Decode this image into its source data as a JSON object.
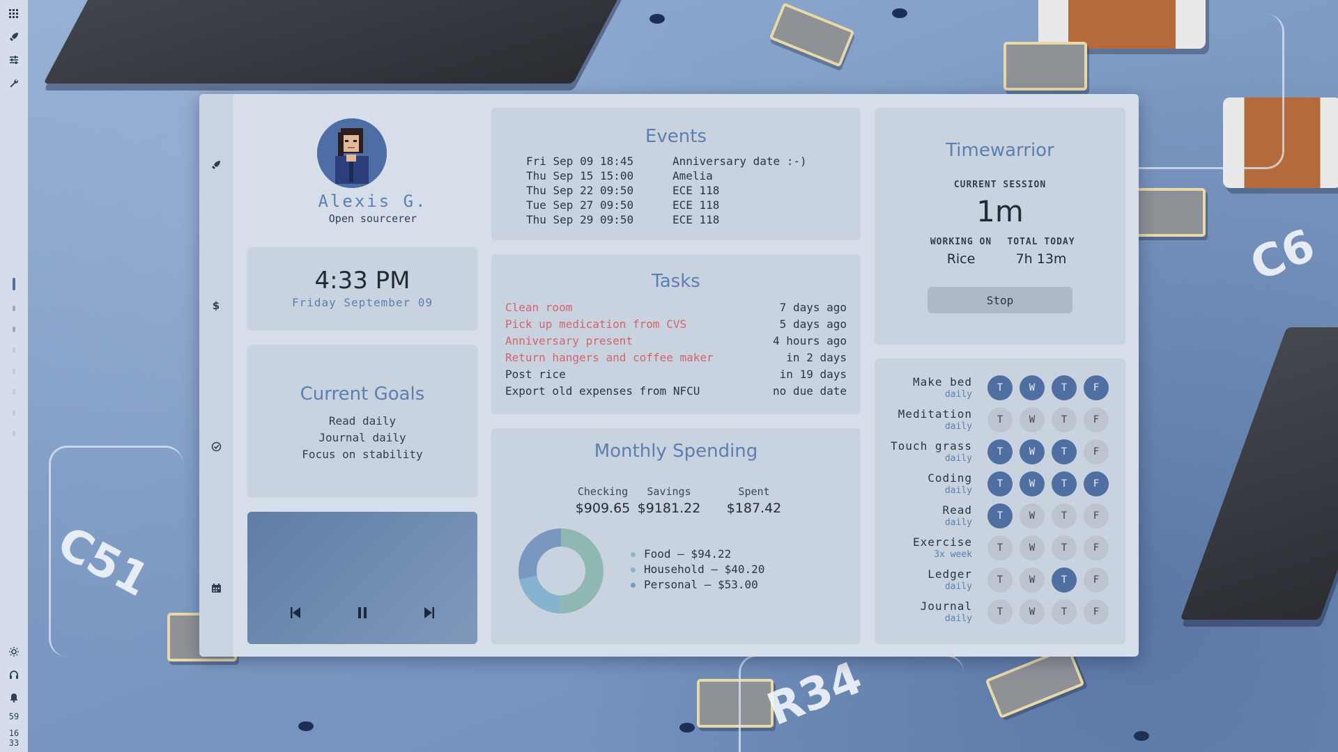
{
  "sysbar": {
    "icons": [
      "grid-icon",
      "rocket-icon",
      "sliders-icon",
      "wrench-icon"
    ],
    "bottom_icons": [
      "brightness-icon",
      "headphones-icon",
      "bell-icon"
    ],
    "battery": "59",
    "clock_hour": "16",
    "clock_minute": "33"
  },
  "rail": {
    "icons": [
      "rocket-icon",
      "dollar-icon",
      "check-circle-icon",
      "calendar-icon"
    ]
  },
  "profile": {
    "name": "Alexis G.",
    "role": "Open sourcerer"
  },
  "clock": {
    "time": "4:33 PM",
    "date": "Friday September 09"
  },
  "goals": {
    "title": "Current Goals",
    "items": [
      "Read daily",
      "Journal daily",
      "Focus on stability"
    ]
  },
  "events": {
    "title": "Events",
    "items": [
      {
        "date": "Fri Sep 09 18:45",
        "name": "Anniversary date :-)"
      },
      {
        "date": "Thu Sep 15 15:00",
        "name": "Amelia"
      },
      {
        "date": "Thu Sep 22 09:50",
        "name": "ECE 118"
      },
      {
        "date": "Tue Sep 27 09:50",
        "name": "ECE 118"
      },
      {
        "date": "Thu Sep 29 09:50",
        "name": "ECE 118"
      }
    ]
  },
  "tasks": {
    "title": "Tasks",
    "items": [
      {
        "name": "Clean room",
        "due": "7 days ago",
        "overdue": true
      },
      {
        "name": "Pick up medication from CVS",
        "due": "5 days ago",
        "overdue": true
      },
      {
        "name": "Anniversary present",
        "due": "4 hours ago",
        "overdue": true
      },
      {
        "name": "Return hangers and coffee maker",
        "due": "in 2 days",
        "overdue": true
      },
      {
        "name": "Post rice",
        "due": "in 19 days",
        "overdue": false
      },
      {
        "name": "Export old expenses from NFCU",
        "due": "no due date",
        "overdue": false
      }
    ]
  },
  "spending": {
    "title": "Monthly Spending",
    "accounts": [
      {
        "label": "Checking",
        "value": "$909.65"
      },
      {
        "label": "Savings",
        "value": "$9181.22"
      },
      {
        "label": "Spent",
        "value": "$187.42"
      }
    ],
    "categories": [
      {
        "label": "Food — $94.22",
        "amount": 94.22,
        "color": "#8fb8b3"
      },
      {
        "label": "Household — $40.20",
        "amount": 40.2,
        "color": "#86b3cf"
      },
      {
        "label": "Personal — $53.00",
        "amount": 53.0,
        "color": "#7a97bf"
      }
    ]
  },
  "timewarrior": {
    "title": "Timewarrior",
    "session_label": "CURRENT SESSION",
    "session": "1m",
    "working_label": "WORKING ON",
    "working": "Rice",
    "total_label": "TOTAL TODAY",
    "total": "7h 13m",
    "stop_label": "Stop"
  },
  "habits": {
    "days": [
      "T",
      "W",
      "T",
      "F"
    ],
    "items": [
      {
        "name": "Make bed",
        "freq": "daily",
        "done": [
          true,
          true,
          true,
          true
        ]
      },
      {
        "name": "Meditation",
        "freq": "daily",
        "done": [
          false,
          false,
          false,
          false
        ]
      },
      {
        "name": "Touch grass",
        "freq": "daily",
        "done": [
          true,
          true,
          true,
          false
        ]
      },
      {
        "name": "Coding",
        "freq": "daily",
        "done": [
          true,
          true,
          true,
          true
        ]
      },
      {
        "name": "Read",
        "freq": "daily",
        "done": [
          true,
          false,
          false,
          false
        ]
      },
      {
        "name": "Exercise",
        "freq": "3x week",
        "done": [
          false,
          false,
          false,
          false
        ]
      },
      {
        "name": "Ledger",
        "freq": "daily",
        "done": [
          false,
          false,
          true,
          false
        ]
      },
      {
        "name": "Journal",
        "freq": "daily",
        "done": [
          false,
          false,
          false,
          false
        ]
      }
    ]
  }
}
